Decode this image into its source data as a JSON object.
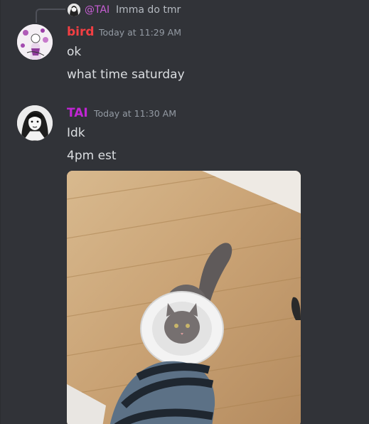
{
  "reply": {
    "mention": "@TAI",
    "text": "Imma do tmr"
  },
  "messages": [
    {
      "username": "bird",
      "username_color": "#f23f43",
      "timestamp": "Today at 11:29 AM",
      "lines": [
        "ok",
        "what time saturday"
      ]
    },
    {
      "username": "TAI",
      "username_color": "#c026d3",
      "timestamp": "Today at 11:30 AM",
      "lines": [
        "Idk",
        "4pm est"
      ],
      "attachment": "cat-photo"
    }
  ],
  "colors": {
    "background": "#313338",
    "text": "#dbdee1",
    "muted": "#949ba4"
  }
}
